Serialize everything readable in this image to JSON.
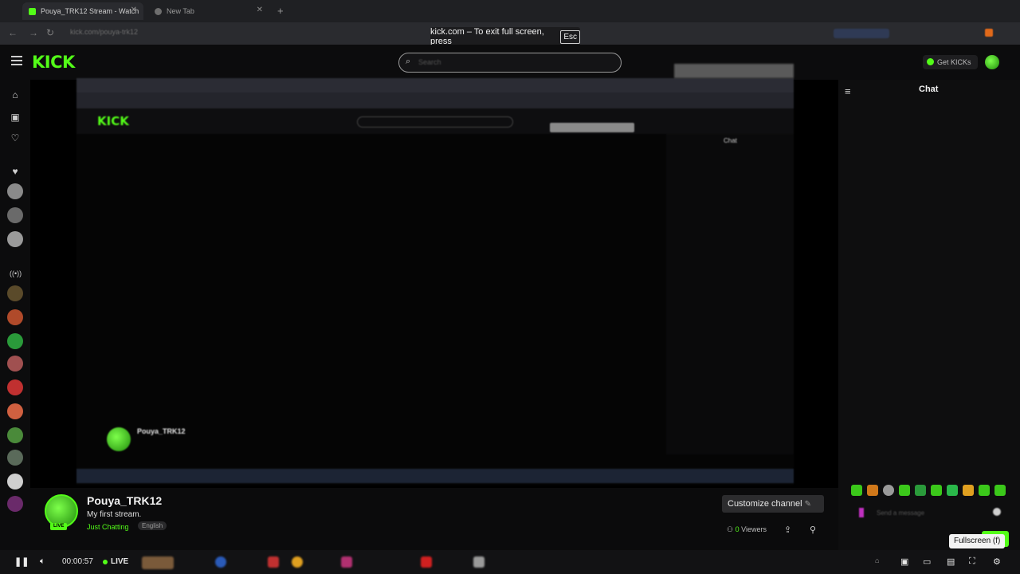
{
  "browser": {
    "tabs": [
      {
        "label": "Pouya_TRK12 Stream - Watch",
        "active": true
      },
      {
        "label": "New Tab",
        "active": false
      }
    ],
    "url": "kick.com/pouya-trk12",
    "fullscreen_notice": "kick.com – To exit full screen, press",
    "fullscreen_key": "Esc"
  },
  "header": {
    "logo": "KICK",
    "search_placeholder": "Search",
    "get_kicks_label": "Get KICKs"
  },
  "chat": {
    "title": "Chat",
    "input_placeholder": "Send a message"
  },
  "channel": {
    "name": "Pouya_TRK12",
    "stream_title": "My first stream.",
    "category": "Just Chatting",
    "language": "English",
    "live_badge": "LIVE",
    "customize_label": "Customize channel",
    "viewers_count": "0",
    "viewers_label": "Viewers"
  },
  "inner": {
    "name": "Pouya_TRK12",
    "chat_title": "Chat"
  },
  "player": {
    "time": "00:00:57",
    "live_label": "LIVE",
    "fullscreen_tooltip": "Fullscreen (f)"
  },
  "colors": {
    "brand": "#53fc18",
    "background": "#0b0b0c"
  }
}
